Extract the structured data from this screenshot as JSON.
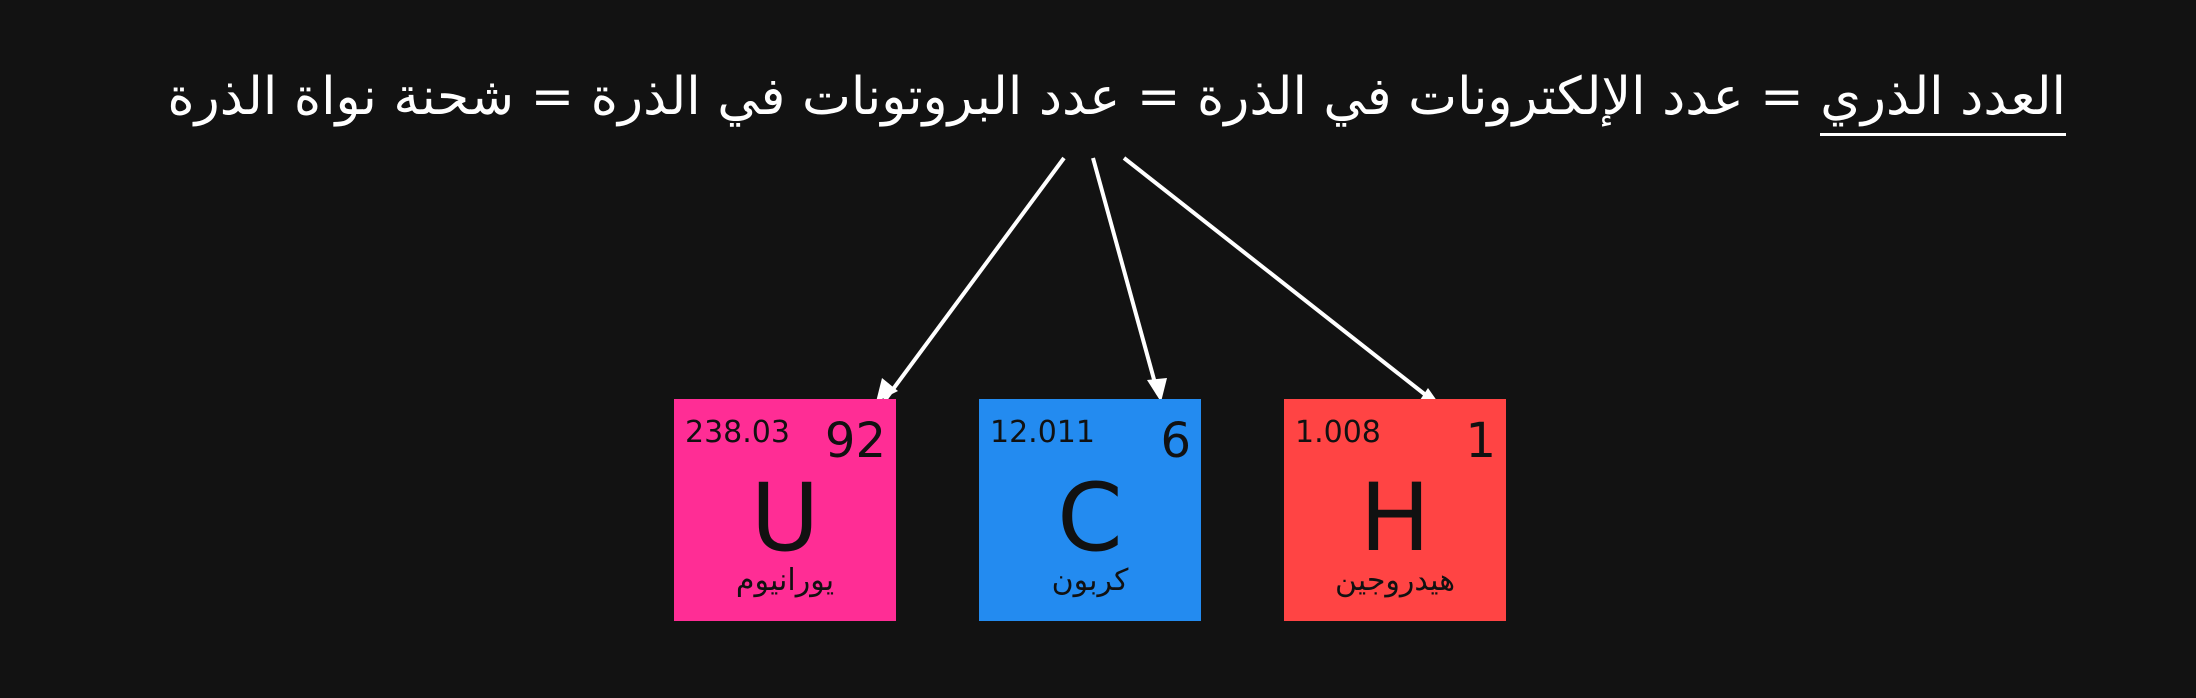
{
  "title": {
    "highlighted": "العدد الذري",
    "rest": " = عدد الإلكترونات في الذرة = عدد البروتونات في الذرة = شحنة نواة الذرة"
  },
  "elements": [
    {
      "symbol": "U",
      "number": "92",
      "mass": "238.03",
      "name": "يورانيوم",
      "color": "#ff2d95"
    },
    {
      "symbol": "C",
      "number": "6",
      "mass": "12.011",
      "name": "كربون",
      "color": "#238bf0"
    },
    {
      "symbol": "H",
      "number": "1",
      "mass": "1.008",
      "name": "هيدروجين",
      "color": "#ff4444"
    }
  ],
  "colors": {
    "background": "#121212",
    "text": "#ffffff",
    "arrow": "#ffffff"
  }
}
